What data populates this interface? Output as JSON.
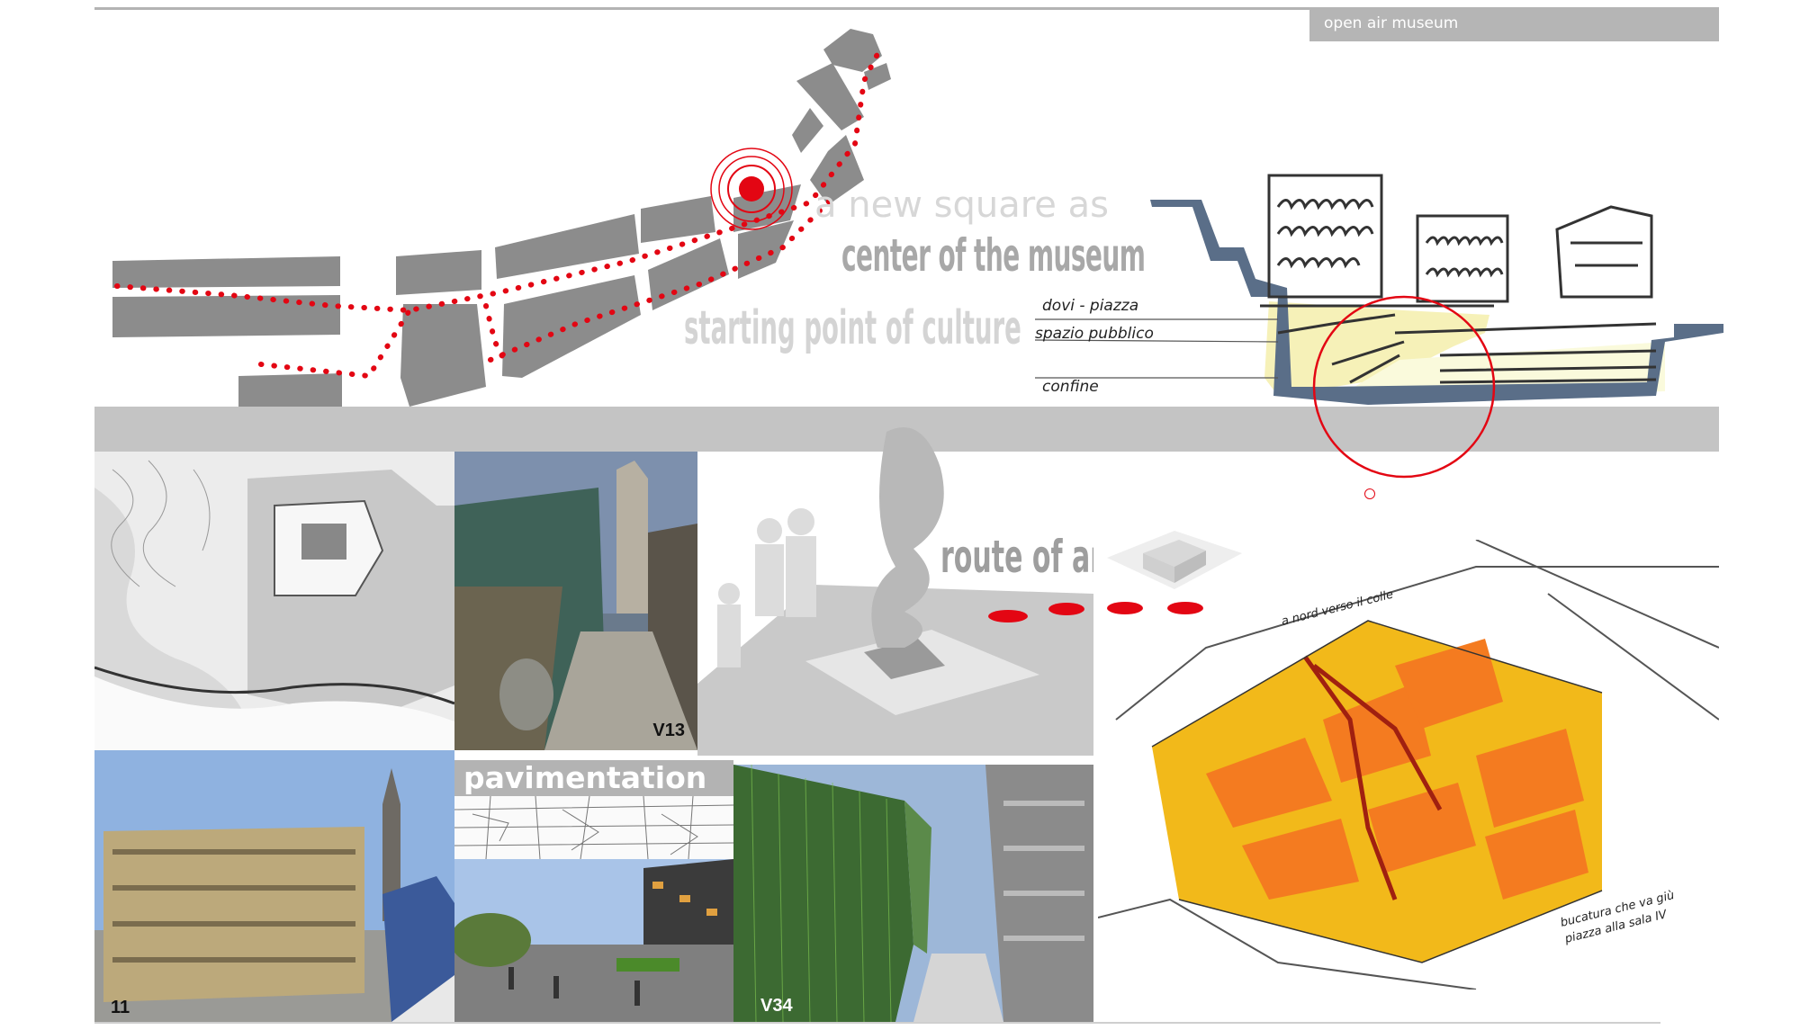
{
  "header": {
    "tag_label": "open air museum"
  },
  "map_overlay": {
    "line1": "a new square as",
    "line2": "center of the museum",
    "line3": "starting point of culture"
  },
  "section_sketch": {
    "notes": [
      "dovi - piazza",
      "spazio pubblico",
      "confine"
    ]
  },
  "sculpture": {
    "label": "route of art"
  },
  "panels": {
    "street_render_code": "V13",
    "building_render_code": "11",
    "pavement_title": "pavimentation",
    "green_wall_code": "V34"
  },
  "plan_sketch": {
    "note_top": "a nord verso il colle",
    "note_bottom_1": "bucatura che va giù",
    "note_bottom_2": "piazza alla sala IV"
  },
  "colors": {
    "accent_red": "#e30613",
    "block_gray": "#8c8c8c",
    "band_gray": "#c4c4c4",
    "tag_gray": "#b5b5b5",
    "sketch_orange": "#f47b20",
    "sketch_yellow": "#f2b91a"
  }
}
